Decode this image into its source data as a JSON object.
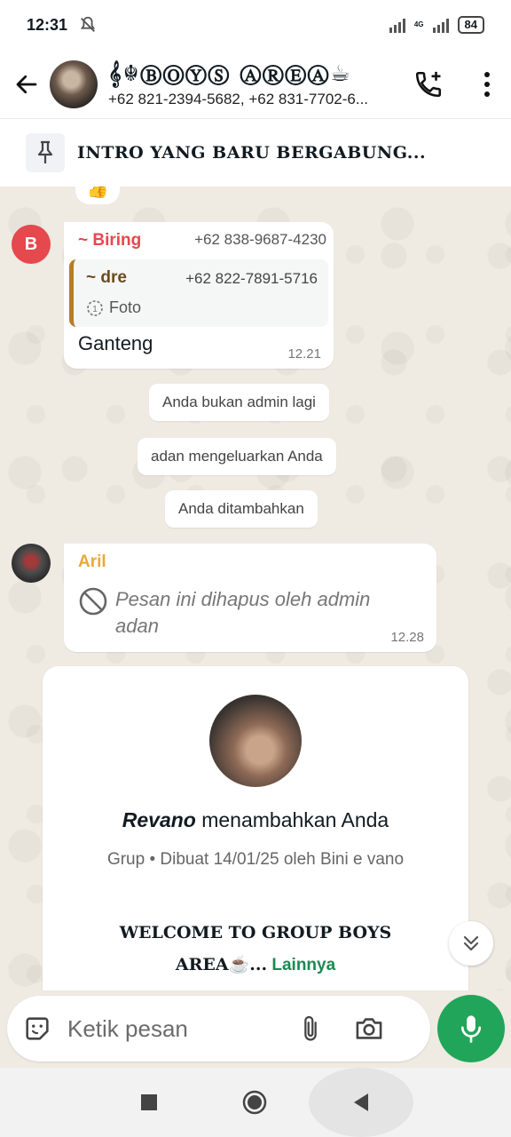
{
  "status_bar": {
    "time": "12:31",
    "network": "4G",
    "battery": "84"
  },
  "header": {
    "group_name": "𝄞☬ⒷⓄⓎⓈ ⒶⓇⒺⒶ☕",
    "members": "+62 821-2394-5682, +62 831-7702-6..."
  },
  "pinned": {
    "text": "INTRO YANG BARU BERGABUNG..."
  },
  "messages": [
    {
      "sender": "~ Biring",
      "avatar_letter": "B",
      "phone": "+62 838-9687-4230",
      "quote": {
        "sender": "~ dre",
        "phone": "+62 822-7891-5716",
        "media": "Foto"
      },
      "text": "Ganteng",
      "time": "12.21"
    },
    {
      "sender": "Aril",
      "text": "Pesan ini dihapus oleh admin adan",
      "time": "12.28"
    }
  ],
  "system_messages": [
    "Anda bukan admin lagi",
    "adan mengeluarkan Anda",
    "Anda ditambahkan"
  ],
  "group_card": {
    "actor": "Revano",
    "action": " menambahkan Anda",
    "subtitle": "Grup • Dibuat 14/01/25 oleh Bini e vano",
    "description": "WELCOME TO GROUP BOYS AREA☕...",
    "more_label": " Lainnya"
  },
  "composer": {
    "placeholder": "Ketik pesan"
  },
  "colors": {
    "accent_green": "#21a55a",
    "biring_name": "#e5484d",
    "aril_name": "#e8a93a",
    "quote_bar": "#b47d2d",
    "link_green": "#1a8a52"
  },
  "icons": [
    "back-arrow-icon",
    "add-call-icon",
    "more-vert-icon",
    "pin-icon",
    "emoji-icon",
    "attach-icon",
    "camera-icon",
    "mic-icon",
    "chevron-double-down-icon",
    "deleted-icon",
    "view-once-icon",
    "mute-bell-icon"
  ]
}
